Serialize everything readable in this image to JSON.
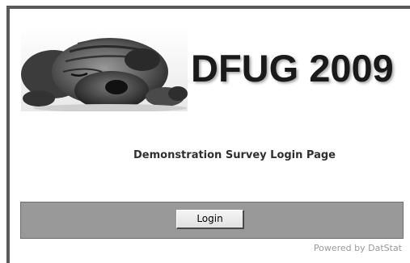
{
  "header": {
    "image_icon": "sleeping-shar-pei-dog-photo",
    "title": "DFUG 2009"
  },
  "main": {
    "heading": "Demonstration Survey Login Page"
  },
  "login": {
    "button_label": "Login"
  },
  "footer": {
    "powered_by": "Powered by DatStat"
  },
  "colors": {
    "frame": "#5a5a5a",
    "panel": "#999999",
    "footer_text": "#9a9a9a"
  }
}
